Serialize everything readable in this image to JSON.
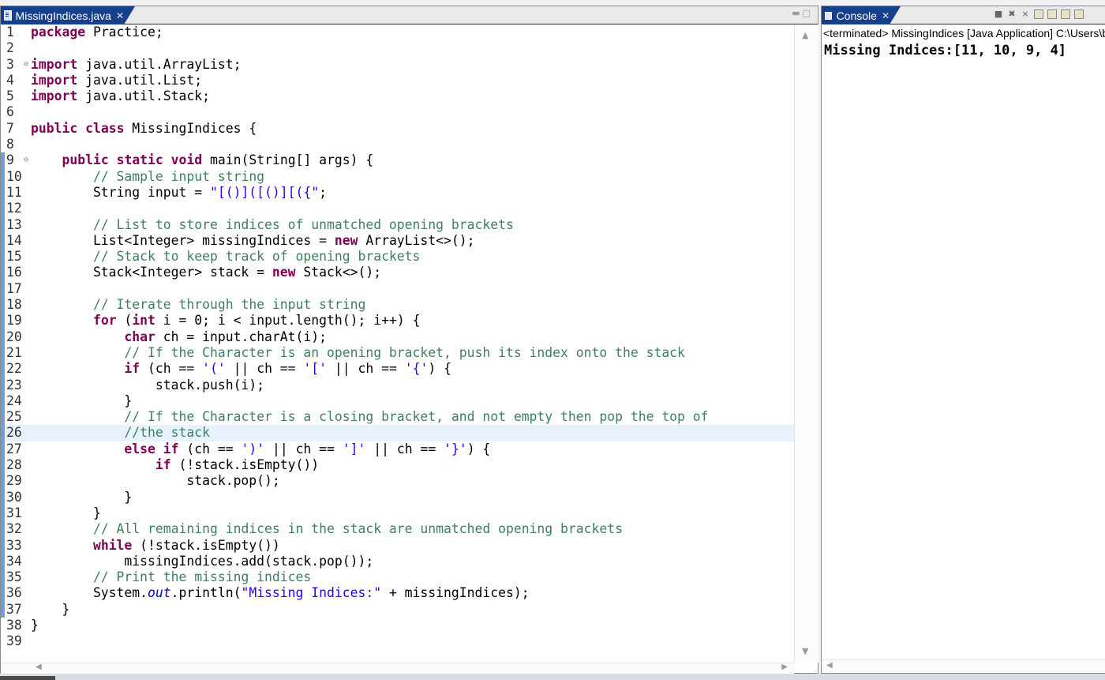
{
  "editor": {
    "tab_title": "MissingIndices.java",
    "close_glyph": "✕",
    "current_line": 26,
    "changed_lines": [
      9,
      10,
      11,
      12,
      13,
      14,
      15,
      16,
      17,
      18,
      19,
      20,
      21,
      22,
      23,
      24,
      25,
      26,
      27,
      28,
      29,
      30,
      31,
      32,
      33,
      34,
      35,
      36,
      37
    ],
    "folded_markers": [
      3,
      9
    ],
    "lines": [
      [
        [
          "kw",
          "package"
        ],
        [
          "tx",
          " Practice;"
        ]
      ],
      [],
      [
        [
          "kw",
          "import"
        ],
        [
          "tx",
          " java.util.ArrayList;"
        ]
      ],
      [
        [
          "kw",
          "import"
        ],
        [
          "tx",
          " java.util.List;"
        ]
      ],
      [
        [
          "kw",
          "import"
        ],
        [
          "tx",
          " java.util.Stack;"
        ]
      ],
      [],
      [
        [
          "kw",
          "public"
        ],
        [
          "tx",
          " "
        ],
        [
          "kw",
          "class"
        ],
        [
          "tx",
          " MissingIndices {"
        ]
      ],
      [],
      [
        [
          "tx",
          "    "
        ],
        [
          "kw",
          "public"
        ],
        [
          "tx",
          " "
        ],
        [
          "kw",
          "static"
        ],
        [
          "tx",
          " "
        ],
        [
          "kw",
          "void"
        ],
        [
          "tx",
          " main(String[] args) {"
        ]
      ],
      [
        [
          "tx",
          "        "
        ],
        [
          "cm",
          "// Sample input string"
        ]
      ],
      [
        [
          "tx",
          "        String input = "
        ],
        [
          "st",
          "\"[()]([()][({\""
        ],
        [
          "tx",
          ";"
        ]
      ],
      [],
      [
        [
          "tx",
          "        "
        ],
        [
          "cm",
          "// List to store indices of unmatched opening brackets"
        ]
      ],
      [
        [
          "tx",
          "        List<Integer> missingIndices = "
        ],
        [
          "kw",
          "new"
        ],
        [
          "tx",
          " ArrayList<>();"
        ]
      ],
      [
        [
          "tx",
          "        "
        ],
        [
          "cm",
          "// Stack to keep track of opening brackets"
        ]
      ],
      [
        [
          "tx",
          "        Stack<Integer> stack = "
        ],
        [
          "kw",
          "new"
        ],
        [
          "tx",
          " Stack<>();"
        ]
      ],
      [],
      [
        [
          "tx",
          "        "
        ],
        [
          "cm",
          "// Iterate through the input string"
        ]
      ],
      [
        [
          "tx",
          "        "
        ],
        [
          "kw",
          "for"
        ],
        [
          "tx",
          " ("
        ],
        [
          "kw",
          "int"
        ],
        [
          "tx",
          " i = 0; i < input.length(); i++) {"
        ]
      ],
      [
        [
          "tx",
          "            "
        ],
        [
          "kw",
          "char"
        ],
        [
          "tx",
          " ch = input.charAt(i);"
        ]
      ],
      [
        [
          "tx",
          "            "
        ],
        [
          "cm",
          "// If the Character is an opening bracket, push its index onto the stack"
        ]
      ],
      [
        [
          "tx",
          "            "
        ],
        [
          "kw",
          "if"
        ],
        [
          "tx",
          " (ch == "
        ],
        [
          "st",
          "'('"
        ],
        [
          "tx",
          " || ch == "
        ],
        [
          "st",
          "'['"
        ],
        [
          "tx",
          " || ch == "
        ],
        [
          "st",
          "'{'"
        ],
        [
          "tx",
          ") {"
        ]
      ],
      [
        [
          "tx",
          "                stack.push(i);"
        ]
      ],
      [
        [
          "tx",
          "            }"
        ]
      ],
      [
        [
          "tx",
          "            "
        ],
        [
          "cm",
          "// If the Character is a closing bracket, and not empty then pop the top of"
        ]
      ],
      [
        [
          "tx",
          "            "
        ],
        [
          "cm",
          "//the stack"
        ]
      ],
      [
        [
          "tx",
          "            "
        ],
        [
          "kw",
          "else"
        ],
        [
          "tx",
          " "
        ],
        [
          "kw",
          "if"
        ],
        [
          "tx",
          " (ch == "
        ],
        [
          "st",
          "')'"
        ],
        [
          "tx",
          " || ch == "
        ],
        [
          "st",
          "']'"
        ],
        [
          "tx",
          " || ch == "
        ],
        [
          "st",
          "'}'"
        ],
        [
          "tx",
          ") {"
        ]
      ],
      [
        [
          "tx",
          "                "
        ],
        [
          "kw",
          "if"
        ],
        [
          "tx",
          " (!stack.isEmpty())"
        ]
      ],
      [
        [
          "tx",
          "                    stack.pop();"
        ]
      ],
      [
        [
          "tx",
          "            }"
        ]
      ],
      [
        [
          "tx",
          "        }"
        ]
      ],
      [
        [
          "tx",
          "        "
        ],
        [
          "cm",
          "// All remaining indices in the stack are unmatched opening brackets"
        ]
      ],
      [
        [
          "tx",
          "        "
        ],
        [
          "kw",
          "while"
        ],
        [
          "tx",
          " (!stack.isEmpty())"
        ]
      ],
      [
        [
          "tx",
          "            missingIndices.add(stack.pop());"
        ]
      ],
      [
        [
          "tx",
          "        "
        ],
        [
          "cm",
          "// Print the missing indices"
        ]
      ],
      [
        [
          "tx",
          "        System."
        ],
        [
          "fi",
          "out"
        ],
        [
          "tx",
          ".println("
        ],
        [
          "st",
          "\"Missing Indices:\""
        ],
        [
          "tx",
          " + missingIndices);"
        ]
      ],
      [
        [
          "tx",
          "    }"
        ]
      ],
      [
        [
          "tx",
          "}"
        ]
      ],
      []
    ]
  },
  "console": {
    "tab_title": "Console",
    "close_glyph": "✕",
    "status": "<terminated> MissingIndices [Java Application] C:\\Users\\bhask",
    "output": "Missing Indices:[11, 10, 9, 4]"
  },
  "colors": {
    "keyword": "#7f0055",
    "comment": "#3f7f5f",
    "string": "#2a00ff",
    "field": "#0000c0",
    "tab_active": "#163f8c",
    "current_line": "#e8f2fe",
    "change_bar": "#6d9fd8"
  },
  "icons": {
    "java_file": "java-file-icon",
    "console": "console-monitor-icon",
    "scroll_up": "▲",
    "scroll_down": "▼",
    "scroll_left": "◀",
    "scroll_right": "▶"
  }
}
